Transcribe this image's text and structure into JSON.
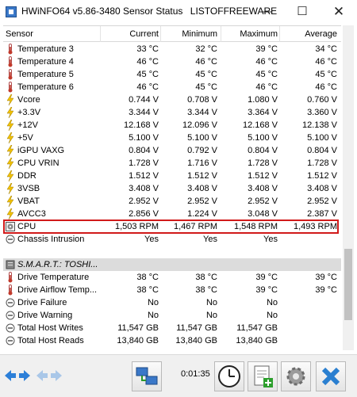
{
  "window": {
    "title": "HWiNFO64 v5.86-3480 Sensor Status",
    "watermark": "LISTOFFREEWARE",
    "minimize_glyph": "—",
    "maximize_glyph": "☐",
    "close_glyph": "✕"
  },
  "columns": [
    "Sensor",
    "Current",
    "Minimum",
    "Maximum",
    "Average"
  ],
  "rows": [
    {
      "icon": "thermometer-icon",
      "name": "Temperature 3",
      "current": "33 °C",
      "min": "32 °C",
      "max": "39 °C",
      "avg": "34 °C"
    },
    {
      "icon": "thermometer-icon",
      "name": "Temperature 4",
      "current": "46 °C",
      "min": "46 °C",
      "max": "46 °C",
      "avg": "46 °C"
    },
    {
      "icon": "thermometer-icon",
      "name": "Temperature 5",
      "current": "45 °C",
      "min": "45 °C",
      "max": "45 °C",
      "avg": "45 °C"
    },
    {
      "icon": "thermometer-icon",
      "name": "Temperature 6",
      "current": "46 °C",
      "min": "45 °C",
      "max": "46 °C",
      "avg": "46 °C"
    },
    {
      "icon": "lightning-icon",
      "name": "Vcore",
      "current": "0.744 V",
      "min": "0.708 V",
      "max": "1.080 V",
      "avg": "0.760 V"
    },
    {
      "icon": "lightning-icon",
      "name": "+3.3V",
      "current": "3.344 V",
      "min": "3.344 V",
      "max": "3.364 V",
      "avg": "3.360 V"
    },
    {
      "icon": "lightning-icon",
      "name": "+12V",
      "current": "12.168 V",
      "min": "12.096 V",
      "max": "12.168 V",
      "avg": "12.138 V"
    },
    {
      "icon": "lightning-icon",
      "name": "+5V",
      "current": "5.100 V",
      "min": "5.100 V",
      "max": "5.100 V",
      "avg": "5.100 V"
    },
    {
      "icon": "lightning-icon",
      "name": "iGPU VAXG",
      "current": "0.804 V",
      "min": "0.792 V",
      "max": "0.804 V",
      "avg": "0.804 V"
    },
    {
      "icon": "lightning-icon",
      "name": "CPU VRIN",
      "current": "1.728 V",
      "min": "1.716 V",
      "max": "1.728 V",
      "avg": "1.728 V"
    },
    {
      "icon": "lightning-icon",
      "name": "DDR",
      "current": "1.512 V",
      "min": "1.512 V",
      "max": "1.512 V",
      "avg": "1.512 V"
    },
    {
      "icon": "lightning-icon",
      "name": "3VSB",
      "current": "3.408 V",
      "min": "3.408 V",
      "max": "3.408 V",
      "avg": "3.408 V"
    },
    {
      "icon": "lightning-icon",
      "name": "VBAT",
      "current": "2.952 V",
      "min": "2.952 V",
      "max": "2.952 V",
      "avg": "2.952 V"
    },
    {
      "icon": "lightning-icon",
      "name": "AVCC3",
      "current": "2.856 V",
      "min": "1.224 V",
      "max": "3.048 V",
      "avg": "2.387 V"
    },
    {
      "icon": "fan-icon",
      "name": "CPU",
      "current": "1,503 RPM",
      "min": "1,467 RPM",
      "max": "1,548 RPM",
      "avg": "1,493 RPM"
    },
    {
      "icon": "circle-minus-icon",
      "name": "Chassis Intrusion",
      "current": "Yes",
      "min": "Yes",
      "max": "Yes",
      "avg": ""
    },
    {
      "icon": "",
      "name": "",
      "current": "",
      "min": "",
      "max": "",
      "avg": ""
    },
    {
      "icon": "drive-icon",
      "name": "S.M.A.R.T.: TOSHI...",
      "current": "",
      "min": "",
      "max": "",
      "avg": "",
      "section": true
    },
    {
      "icon": "thermometer-icon",
      "name": "Drive Temperature",
      "current": "38 °C",
      "min": "38 °C",
      "max": "39 °C",
      "avg": "39 °C"
    },
    {
      "icon": "thermometer-icon",
      "name": "Drive Airflow Temp...",
      "current": "38 °C",
      "min": "38 °C",
      "max": "39 °C",
      "avg": "39 °C"
    },
    {
      "icon": "circle-minus-icon",
      "name": "Drive Failure",
      "current": "No",
      "min": "No",
      "max": "No",
      "avg": ""
    },
    {
      "icon": "circle-minus-icon",
      "name": "Drive Warning",
      "current": "No",
      "min": "No",
      "max": "No",
      "avg": ""
    },
    {
      "icon": "circle-minus-icon",
      "name": "Total Host Writes",
      "current": "11,547 GB",
      "min": "11,547 GB",
      "max": "11,547 GB",
      "avg": ""
    },
    {
      "icon": "circle-minus-icon",
      "name": "Total Host Reads",
      "current": "13,840 GB",
      "min": "13,840 GB",
      "max": "13,840 GB",
      "avg": ""
    }
  ],
  "toolbar": {
    "timer": "0:01:35",
    "buttons": [
      "arrows-left-right-icon",
      "arrows-left-right-disabled-icon",
      "network-icon",
      "clock-icon",
      "add-report-icon",
      "settings-gear-icon",
      "reset-x-icon"
    ]
  }
}
